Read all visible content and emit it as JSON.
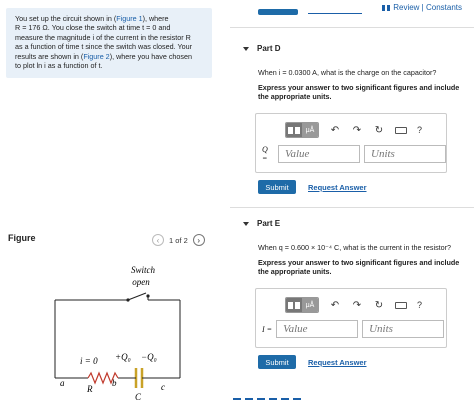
{
  "header": {
    "review_link": "Review | Constants"
  },
  "problem": {
    "line1_a": "You set up the circuit shown in (",
    "line1_link": "Figure 1",
    "line1_b": "), where",
    "line2": "R = 176 Ω. You close the switch at time t = 0 and",
    "line3": "measure the magnitude i of the current in the resistor R",
    "line4": "as a function of time t since the switch was closed. Your",
    "line5_a": "results are shown in (",
    "line5_link": "Figure 2",
    "line5_b": "), where you have chosen",
    "line6": "to plot ln i as a function of t."
  },
  "figure": {
    "title": "Figure",
    "pager": "1 of 2",
    "prev_icon": "chevron-left-icon",
    "next_icon": "chevron-right-icon",
    "labels": {
      "switch": "Switch",
      "open": "open",
      "i0": "i = 0",
      "q_plus": "+Q₀",
      "q_minus": "−Q₀",
      "a": "a",
      "r": "R",
      "b": "b",
      "c_node": "c",
      "c_cap": "C"
    }
  },
  "part_d": {
    "title": "Part D",
    "question": "When i = 0.0300 A, what is the charge on the capacitor?",
    "instruction_1": "Express your answer to two significant figures and include",
    "instruction_2": "the appropriate units.",
    "mu_label": "μÅ",
    "help_label": "?",
    "var_label": "Q =",
    "value_placeholder": "Value",
    "units_placeholder": "Units",
    "submit": "Submit",
    "request": "Request Answer"
  },
  "part_e": {
    "title": "Part E",
    "question": "When q = 0.600 × 10⁻⁴ C, what is the current in the resistor?",
    "instruction_1": "Express your answer to two significant figures and include",
    "instruction_2": "the appropriate units.",
    "mu_label": "μÅ",
    "help_label": "?",
    "var_label": "I =",
    "value_placeholder": "Value",
    "units_placeholder": "Units",
    "submit": "Submit",
    "request": "Request Answer"
  },
  "colors": {
    "accent": "#1e6ba8",
    "link": "#1a5fa8",
    "problem_bg": "#e8f0f8",
    "capacitor": "#c9a227",
    "resistor": "#c0392b"
  }
}
